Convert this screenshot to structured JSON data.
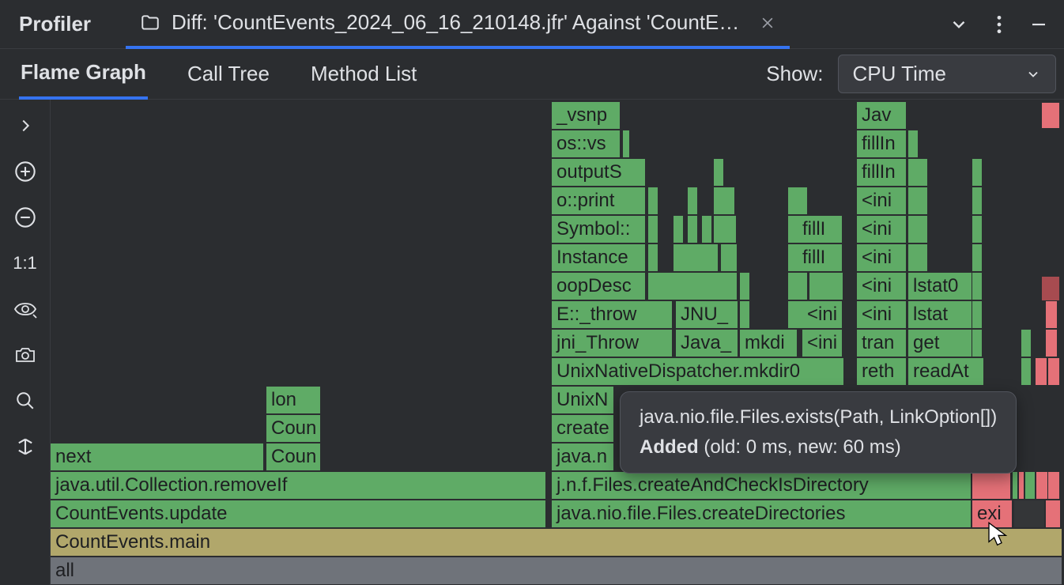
{
  "titlebar": {
    "title": "Profiler",
    "tab_label": "Diff: 'CountEvents_2024_06_16_210148.jfr' Against 'CountEven..."
  },
  "subtabs": {
    "flame": "Flame Graph",
    "calltree": "Call Tree",
    "method": "Method List",
    "show_label": "Show:",
    "show_value": "CPU Time"
  },
  "tools": {
    "scale": "1:1"
  },
  "rows": {
    "r0": "all",
    "r1_main": "CountEvents.main",
    "r2_update": "CountEvents.update",
    "r2_createDirs": "java.nio.file.Files.createDirectories",
    "r2_exi": "exi",
    "r3_removeIf": "java.util.Collection.removeIf",
    "r3_createCheck": "j.n.f.Files.createAndCheckIsDirectory",
    "r4_next": "next",
    "r4_coun": "Coun",
    "r4_javan": "java.n",
    "r5_coun": "Coun",
    "r5_create": "create",
    "r6_lon": "lon",
    "r6_unixn": "UnixN",
    "r7_unixnative": "UnixNativeDispatcher.mkdir0",
    "r7_reth": "reth",
    "r7_readAt": "readAt",
    "r8_jni": "jni_Throw",
    "r8_java": "Java_",
    "r8_mkdi": "mkdi",
    "r8_ini": "<ini",
    "r8_tran": "tran",
    "r8_get": "get",
    "r9_ethrow": "E::_throw",
    "r9_jnu": "JNU_",
    "r9_ini": "<ini",
    "r9_lstat": "lstat",
    "r10_oop": "oopDesc",
    "r10_ini": "<ini",
    "r10_lstat0": "lstat0",
    "r11_instance": "Instance",
    "r11_fill": "fillI",
    "r11_ini": "<ini",
    "r12_symbol": "Symbol::",
    "r12_fill": "fillI",
    "r12_ini": "<ini",
    "r13_oprint": "o::print",
    "r13_ini": "<ini",
    "r14_outputs": "outputS",
    "r14_fillin": "fillIn",
    "r15_osvs": "os::vs",
    "r15_fillin": "fillIn",
    "r16_vsnp": "_vsnp",
    "r16_jav": "Jav"
  },
  "tooltip": {
    "method": "java.nio.file.Files.exists(Path, LinkOption[])",
    "status": "Added",
    "detail": " (old: 0 ms, new: 60 ms)"
  }
}
